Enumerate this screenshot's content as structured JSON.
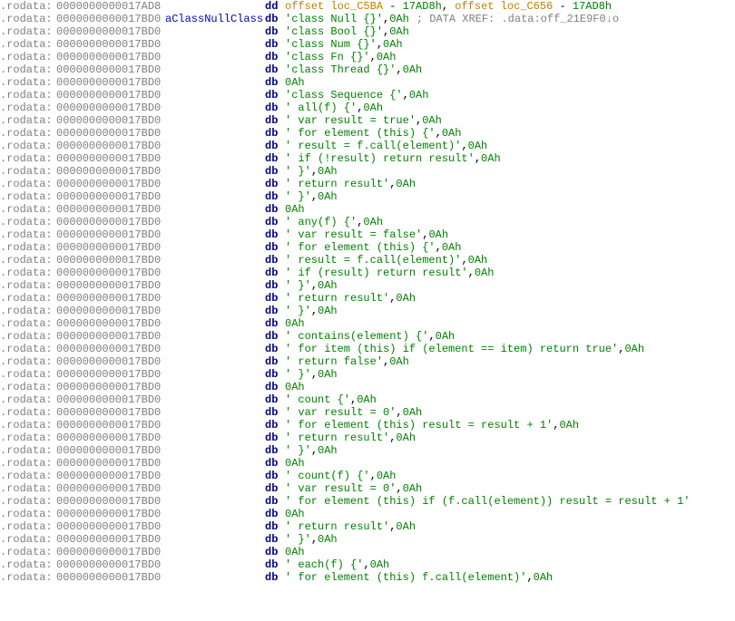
{
  "lines": [
    {
      "seg": ".rodata:",
      "addr": "0000000000017AD8",
      "label": "",
      "mnem": "dd",
      "parts": [
        {
          "t": "off",
          "v": "offset loc_C5BA"
        },
        {
          "t": "op",
          "v": " - "
        },
        {
          "t": "num",
          "v": "17AD8h"
        },
        {
          "t": "op",
          "v": ", "
        },
        {
          "t": "off",
          "v": "offset loc_C656"
        },
        {
          "t": "op",
          "v": " - "
        },
        {
          "t": "num",
          "v": "17AD8h"
        }
      ],
      "cmt": ""
    },
    {
      "seg": ".rodata:",
      "addr": "0000000000017BD0",
      "label": "aClassNullClass",
      "mnem": "db",
      "parts": [
        {
          "t": "str",
          "v": "'class Null {}'"
        },
        {
          "t": "op",
          "v": ","
        },
        {
          "t": "num",
          "v": "0Ah"
        }
      ],
      "cmt": "; DATA XREF: .data:off_21E9F0↓o"
    },
    {
      "seg": ".rodata:",
      "addr": "0000000000017BD0",
      "label": "",
      "mnem": "db",
      "parts": [
        {
          "t": "str",
          "v": "'class Bool {}'"
        },
        {
          "t": "op",
          "v": ","
        },
        {
          "t": "num",
          "v": "0Ah"
        }
      ],
      "cmt": ""
    },
    {
      "seg": ".rodata:",
      "addr": "0000000000017BD0",
      "label": "",
      "mnem": "db",
      "parts": [
        {
          "t": "str",
          "v": "'class Num {}'"
        },
        {
          "t": "op",
          "v": ","
        },
        {
          "t": "num",
          "v": "0Ah"
        }
      ],
      "cmt": ""
    },
    {
      "seg": ".rodata:",
      "addr": "0000000000017BD0",
      "label": "",
      "mnem": "db",
      "parts": [
        {
          "t": "str",
          "v": "'class Fn {}'"
        },
        {
          "t": "op",
          "v": ","
        },
        {
          "t": "num",
          "v": "0Ah"
        }
      ],
      "cmt": ""
    },
    {
      "seg": ".rodata:",
      "addr": "0000000000017BD0",
      "label": "",
      "mnem": "db",
      "parts": [
        {
          "t": "str",
          "v": "'class Thread {}'"
        },
        {
          "t": "op",
          "v": ","
        },
        {
          "t": "num",
          "v": "0Ah"
        }
      ],
      "cmt": ""
    },
    {
      "seg": ".rodata:",
      "addr": "0000000000017BD0",
      "label": "",
      "mnem": "db",
      "parts": [
        {
          "t": "num",
          "v": "0Ah"
        }
      ],
      "cmt": ""
    },
    {
      "seg": ".rodata:",
      "addr": "0000000000017BD0",
      "label": "",
      "mnem": "db",
      "parts": [
        {
          "t": "str",
          "v": "'class Sequence {'"
        },
        {
          "t": "op",
          "v": ","
        },
        {
          "t": "num",
          "v": "0Ah"
        }
      ],
      "cmt": ""
    },
    {
      "seg": ".rodata:",
      "addr": "0000000000017BD0",
      "label": "",
      "mnem": "db",
      "parts": [
        {
          "t": "str",
          "v": "'    all(f) {'"
        },
        {
          "t": "op",
          "v": ","
        },
        {
          "t": "num",
          "v": "0Ah"
        }
      ],
      "cmt": ""
    },
    {
      "seg": ".rodata:",
      "addr": "0000000000017BD0",
      "label": "",
      "mnem": "db",
      "parts": [
        {
          "t": "str",
          "v": "'        var result = true'"
        },
        {
          "t": "op",
          "v": ","
        },
        {
          "t": "num",
          "v": "0Ah"
        }
      ],
      "cmt": ""
    },
    {
      "seg": ".rodata:",
      "addr": "0000000000017BD0",
      "label": "",
      "mnem": "db",
      "parts": [
        {
          "t": "str",
          "v": "'        for element (this) {'"
        },
        {
          "t": "op",
          "v": ","
        },
        {
          "t": "num",
          "v": "0Ah"
        }
      ],
      "cmt": ""
    },
    {
      "seg": ".rodata:",
      "addr": "0000000000017BD0",
      "label": "",
      "mnem": "db",
      "parts": [
        {
          "t": "str",
          "v": "'            result = f.call(element)'"
        },
        {
          "t": "op",
          "v": ","
        },
        {
          "t": "num",
          "v": "0Ah"
        }
      ],
      "cmt": ""
    },
    {
      "seg": ".rodata:",
      "addr": "0000000000017BD0",
      "label": "",
      "mnem": "db",
      "parts": [
        {
          "t": "str",
          "v": "'            if (!result) return result'"
        },
        {
          "t": "op",
          "v": ","
        },
        {
          "t": "num",
          "v": "0Ah"
        }
      ],
      "cmt": ""
    },
    {
      "seg": ".rodata:",
      "addr": "0000000000017BD0",
      "label": "",
      "mnem": "db",
      "parts": [
        {
          "t": "str",
          "v": "'        }'"
        },
        {
          "t": "op",
          "v": ","
        },
        {
          "t": "num",
          "v": "0Ah"
        }
      ],
      "cmt": ""
    },
    {
      "seg": ".rodata:",
      "addr": "0000000000017BD0",
      "label": "",
      "mnem": "db",
      "parts": [
        {
          "t": "str",
          "v": "'        return result'"
        },
        {
          "t": "op",
          "v": ","
        },
        {
          "t": "num",
          "v": "0Ah"
        }
      ],
      "cmt": ""
    },
    {
      "seg": ".rodata:",
      "addr": "0000000000017BD0",
      "label": "",
      "mnem": "db",
      "parts": [
        {
          "t": "str",
          "v": "'    }'"
        },
        {
          "t": "op",
          "v": ","
        },
        {
          "t": "num",
          "v": "0Ah"
        }
      ],
      "cmt": ""
    },
    {
      "seg": ".rodata:",
      "addr": "0000000000017BD0",
      "label": "",
      "mnem": "db",
      "parts": [
        {
          "t": "num",
          "v": "0Ah"
        }
      ],
      "cmt": ""
    },
    {
      "seg": ".rodata:",
      "addr": "0000000000017BD0",
      "label": "",
      "mnem": "db",
      "parts": [
        {
          "t": "str",
          "v": "'    any(f) {'"
        },
        {
          "t": "op",
          "v": ","
        },
        {
          "t": "num",
          "v": "0Ah"
        }
      ],
      "cmt": ""
    },
    {
      "seg": ".rodata:",
      "addr": "0000000000017BD0",
      "label": "",
      "mnem": "db",
      "parts": [
        {
          "t": "str",
          "v": "'        var result = false'"
        },
        {
          "t": "op",
          "v": ","
        },
        {
          "t": "num",
          "v": "0Ah"
        }
      ],
      "cmt": ""
    },
    {
      "seg": ".rodata:",
      "addr": "0000000000017BD0",
      "label": "",
      "mnem": "db",
      "parts": [
        {
          "t": "str",
          "v": "'        for element (this) {'"
        },
        {
          "t": "op",
          "v": ","
        },
        {
          "t": "num",
          "v": "0Ah"
        }
      ],
      "cmt": ""
    },
    {
      "seg": ".rodata:",
      "addr": "0000000000017BD0",
      "label": "",
      "mnem": "db",
      "parts": [
        {
          "t": "str",
          "v": "'            result = f.call(element)'"
        },
        {
          "t": "op",
          "v": ","
        },
        {
          "t": "num",
          "v": "0Ah"
        }
      ],
      "cmt": ""
    },
    {
      "seg": ".rodata:",
      "addr": "0000000000017BD0",
      "label": "",
      "mnem": "db",
      "parts": [
        {
          "t": "str",
          "v": "'            if (result) return result'"
        },
        {
          "t": "op",
          "v": ","
        },
        {
          "t": "num",
          "v": "0Ah"
        }
      ],
      "cmt": ""
    },
    {
      "seg": ".rodata:",
      "addr": "0000000000017BD0",
      "label": "",
      "mnem": "db",
      "parts": [
        {
          "t": "str",
          "v": "'        }'"
        },
        {
          "t": "op",
          "v": ","
        },
        {
          "t": "num",
          "v": "0Ah"
        }
      ],
      "cmt": ""
    },
    {
      "seg": ".rodata:",
      "addr": "0000000000017BD0",
      "label": "",
      "mnem": "db",
      "parts": [
        {
          "t": "str",
          "v": "'        return result'"
        },
        {
          "t": "op",
          "v": ","
        },
        {
          "t": "num",
          "v": "0Ah"
        }
      ],
      "cmt": ""
    },
    {
      "seg": ".rodata:",
      "addr": "0000000000017BD0",
      "label": "",
      "mnem": "db",
      "parts": [
        {
          "t": "str",
          "v": "'    }'"
        },
        {
          "t": "op",
          "v": ","
        },
        {
          "t": "num",
          "v": "0Ah"
        }
      ],
      "cmt": ""
    },
    {
      "seg": ".rodata:",
      "addr": "0000000000017BD0",
      "label": "",
      "mnem": "db",
      "parts": [
        {
          "t": "num",
          "v": "0Ah"
        }
      ],
      "cmt": ""
    },
    {
      "seg": ".rodata:",
      "addr": "0000000000017BD0",
      "label": "",
      "mnem": "db",
      "parts": [
        {
          "t": "str",
          "v": "'    contains(element) {'"
        },
        {
          "t": "op",
          "v": ","
        },
        {
          "t": "num",
          "v": "0Ah"
        }
      ],
      "cmt": ""
    },
    {
      "seg": ".rodata:",
      "addr": "0000000000017BD0",
      "label": "",
      "mnem": "db",
      "parts": [
        {
          "t": "str",
          "v": "'        for item (this) if (element == item) return true'"
        },
        {
          "t": "op",
          "v": ","
        },
        {
          "t": "num",
          "v": "0Ah"
        }
      ],
      "cmt": ""
    },
    {
      "seg": ".rodata:",
      "addr": "0000000000017BD0",
      "label": "",
      "mnem": "db",
      "parts": [
        {
          "t": "str",
          "v": "'        return false'"
        },
        {
          "t": "op",
          "v": ","
        },
        {
          "t": "num",
          "v": "0Ah"
        }
      ],
      "cmt": ""
    },
    {
      "seg": ".rodata:",
      "addr": "0000000000017BD0",
      "label": "",
      "mnem": "db",
      "parts": [
        {
          "t": "str",
          "v": "'    }'"
        },
        {
          "t": "op",
          "v": ","
        },
        {
          "t": "num",
          "v": "0Ah"
        }
      ],
      "cmt": ""
    },
    {
      "seg": ".rodata:",
      "addr": "0000000000017BD0",
      "label": "",
      "mnem": "db",
      "parts": [
        {
          "t": "num",
          "v": "0Ah"
        }
      ],
      "cmt": ""
    },
    {
      "seg": ".rodata:",
      "addr": "0000000000017BD0",
      "label": "",
      "mnem": "db",
      "parts": [
        {
          "t": "str",
          "v": "'    count {'"
        },
        {
          "t": "op",
          "v": ","
        },
        {
          "t": "num",
          "v": "0Ah"
        }
      ],
      "cmt": ""
    },
    {
      "seg": ".rodata:",
      "addr": "0000000000017BD0",
      "label": "",
      "mnem": "db",
      "parts": [
        {
          "t": "str",
          "v": "'        var result = 0'"
        },
        {
          "t": "op",
          "v": ","
        },
        {
          "t": "num",
          "v": "0Ah"
        }
      ],
      "cmt": ""
    },
    {
      "seg": ".rodata:",
      "addr": "0000000000017BD0",
      "label": "",
      "mnem": "db",
      "parts": [
        {
          "t": "str",
          "v": "'        for element (this) result = result + 1'"
        },
        {
          "t": "op",
          "v": ","
        },
        {
          "t": "num",
          "v": "0Ah"
        }
      ],
      "cmt": ""
    },
    {
      "seg": ".rodata:",
      "addr": "0000000000017BD0",
      "label": "",
      "mnem": "db",
      "parts": [
        {
          "t": "str",
          "v": "'        return result'"
        },
        {
          "t": "op",
          "v": ","
        },
        {
          "t": "num",
          "v": "0Ah"
        }
      ],
      "cmt": ""
    },
    {
      "seg": ".rodata:",
      "addr": "0000000000017BD0",
      "label": "",
      "mnem": "db",
      "parts": [
        {
          "t": "str",
          "v": "'    }'"
        },
        {
          "t": "op",
          "v": ","
        },
        {
          "t": "num",
          "v": "0Ah"
        }
      ],
      "cmt": ""
    },
    {
      "seg": ".rodata:",
      "addr": "0000000000017BD0",
      "label": "",
      "mnem": "db",
      "parts": [
        {
          "t": "num",
          "v": "0Ah"
        }
      ],
      "cmt": ""
    },
    {
      "seg": ".rodata:",
      "addr": "0000000000017BD0",
      "label": "",
      "mnem": "db",
      "parts": [
        {
          "t": "str",
          "v": "'    count(f) {'"
        },
        {
          "t": "op",
          "v": ","
        },
        {
          "t": "num",
          "v": "0Ah"
        }
      ],
      "cmt": ""
    },
    {
      "seg": ".rodata:",
      "addr": "0000000000017BD0",
      "label": "",
      "mnem": "db",
      "parts": [
        {
          "t": "str",
          "v": "'        var result = 0'"
        },
        {
          "t": "op",
          "v": ","
        },
        {
          "t": "num",
          "v": "0Ah"
        }
      ],
      "cmt": ""
    },
    {
      "seg": ".rodata:",
      "addr": "0000000000017BD0",
      "label": "",
      "mnem": "db",
      "parts": [
        {
          "t": "str",
          "v": "'        for element (this) if (f.call(element)) result = result + 1'"
        }
      ],
      "cmt": ""
    },
    {
      "seg": ".rodata:",
      "addr": "0000000000017BD0",
      "label": "",
      "mnem": "db",
      "parts": [
        {
          "t": "num",
          "v": "0Ah"
        }
      ],
      "cmt": ""
    },
    {
      "seg": ".rodata:",
      "addr": "0000000000017BD0",
      "label": "",
      "mnem": "db",
      "parts": [
        {
          "t": "str",
          "v": "'        return result'"
        },
        {
          "t": "op",
          "v": ","
        },
        {
          "t": "num",
          "v": "0Ah"
        }
      ],
      "cmt": ""
    },
    {
      "seg": ".rodata:",
      "addr": "0000000000017BD0",
      "label": "",
      "mnem": "db",
      "parts": [
        {
          "t": "str",
          "v": "'    }'"
        },
        {
          "t": "op",
          "v": ","
        },
        {
          "t": "num",
          "v": "0Ah"
        }
      ],
      "cmt": ""
    },
    {
      "seg": ".rodata:",
      "addr": "0000000000017BD0",
      "label": "",
      "mnem": "db",
      "parts": [
        {
          "t": "num",
          "v": "0Ah"
        }
      ],
      "cmt": ""
    },
    {
      "seg": ".rodata:",
      "addr": "0000000000017BD0",
      "label": "",
      "mnem": "db",
      "parts": [
        {
          "t": "str",
          "v": "'    each(f) {'"
        },
        {
          "t": "op",
          "v": ","
        },
        {
          "t": "num",
          "v": "0Ah"
        }
      ],
      "cmt": ""
    },
    {
      "seg": ".rodata:",
      "addr": "0000000000017BD0",
      "label": "",
      "mnem": "db",
      "parts": [
        {
          "t": "str",
          "v": "'        for element (this) f.call(element)'"
        },
        {
          "t": "op",
          "v": ","
        },
        {
          "t": "num",
          "v": "0Ah"
        }
      ],
      "cmt": ""
    }
  ]
}
